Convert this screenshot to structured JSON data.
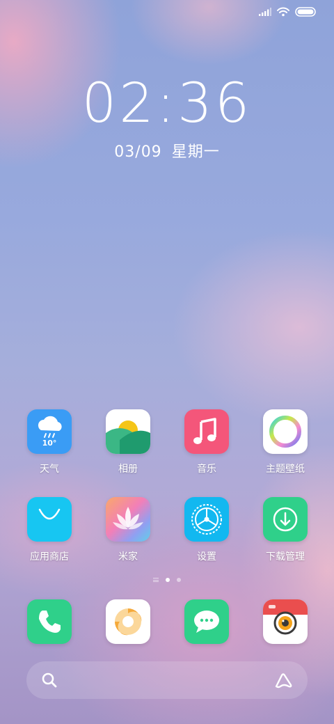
{
  "status_bar": {
    "icons": [
      "signal-icon",
      "wifi-icon",
      "battery-icon"
    ]
  },
  "clock": {
    "time": "02:36",
    "date": "03/09",
    "weekday": "星期一"
  },
  "apps": [
    {
      "label": "天气",
      "icon": "weather-icon",
      "badge": "10°"
    },
    {
      "label": "相册",
      "icon": "gallery-icon"
    },
    {
      "label": "音乐",
      "icon": "music-icon"
    },
    {
      "label": "主题壁纸",
      "icon": "themes-icon"
    },
    {
      "label": "应用商店",
      "icon": "app-store-icon"
    },
    {
      "label": "米家",
      "icon": "mijia-icon"
    },
    {
      "label": "设置",
      "icon": "settings-icon"
    },
    {
      "label": "下载管理",
      "icon": "downloads-icon"
    }
  ],
  "page_indicator": {
    "pages": 2,
    "current": 1
  },
  "dock": [
    {
      "icon": "phone-icon"
    },
    {
      "icon": "browser-icon"
    },
    {
      "icon": "messages-icon"
    },
    {
      "icon": "camera-icon"
    }
  ],
  "search": {
    "icons": [
      "search-icon",
      "assistant-icon"
    ]
  },
  "colors": {
    "weather": "#3a9cf5",
    "music": "#f4567a",
    "app_store": "#17c6f2",
    "settings": "#12b8f0",
    "downloads": "#2fd08a",
    "phone": "#2fd08a",
    "messages": "#2fd08a",
    "camera": "#ea4e4e"
  }
}
